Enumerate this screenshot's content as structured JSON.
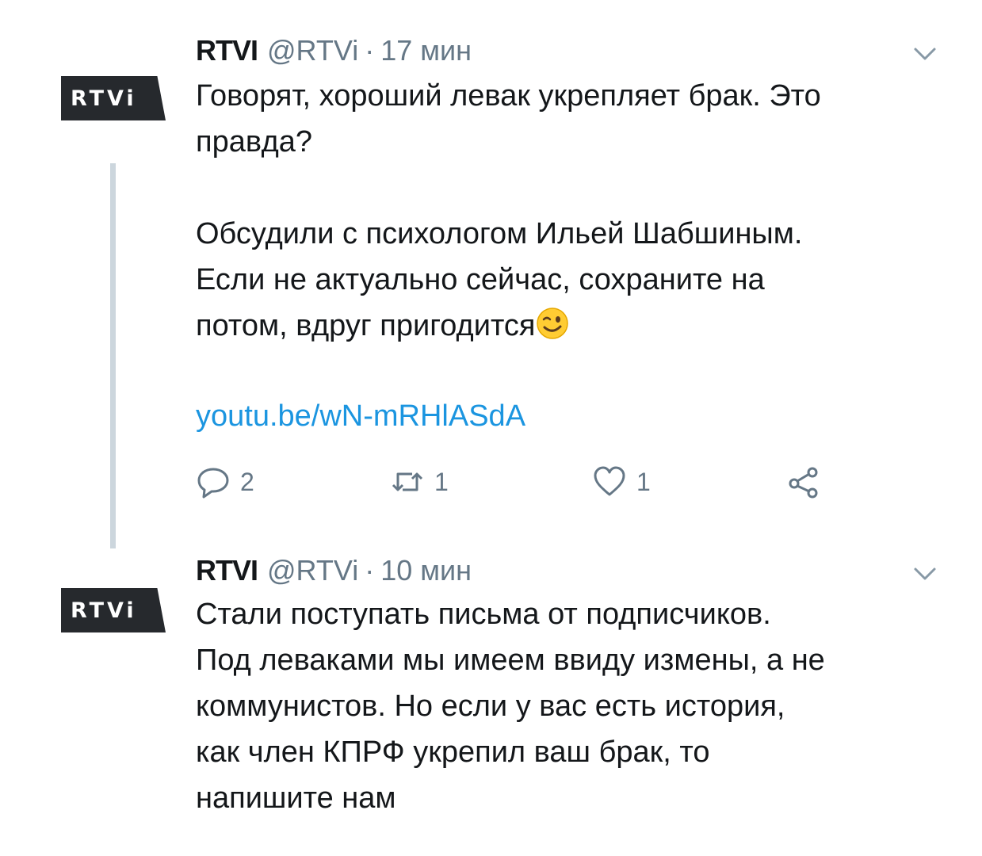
{
  "tweets": [
    {
      "avatar_text": "RTVi",
      "name": "RTVI",
      "handle": "@RTVi",
      "separator": "·",
      "time": "17 мин",
      "text_before_emoji": "Говорят, хороший левак укрепляет брак. Это\nправда?\n\nОбсудили с психологом Ильей Шабшиным.\nЕсли не актуально сейчас, сохраните на\nпотом, вдруг пригодится",
      "emoji": "winking-face-emoji",
      "link": "youtu.be/wN-mRHlASdA",
      "actions": {
        "reply": {
          "icon": "reply-icon",
          "count": "2"
        },
        "retweet": {
          "icon": "retweet-icon",
          "count": "1"
        },
        "like": {
          "icon": "heart-icon",
          "count": "1"
        },
        "share": {
          "icon": "share-icon"
        }
      }
    },
    {
      "avatar_text": "RTVi",
      "name": "RTVI",
      "handle": "@RTVi",
      "separator": "·",
      "time": "10 мин",
      "text": "Стали поступать письма от подписчиков.\nПод леваками мы имеем ввиду измены, а не\nкоммунистов. Но если у вас есть история,\nкак член КПРФ укрепил ваш брак, то\nнапишите нам"
    }
  ],
  "colors": {
    "text": "#14171a",
    "secondary": "#657786",
    "link": "#1b95e0",
    "thread_line": "#ccd6dd",
    "avatar_bg": "#26292d"
  }
}
